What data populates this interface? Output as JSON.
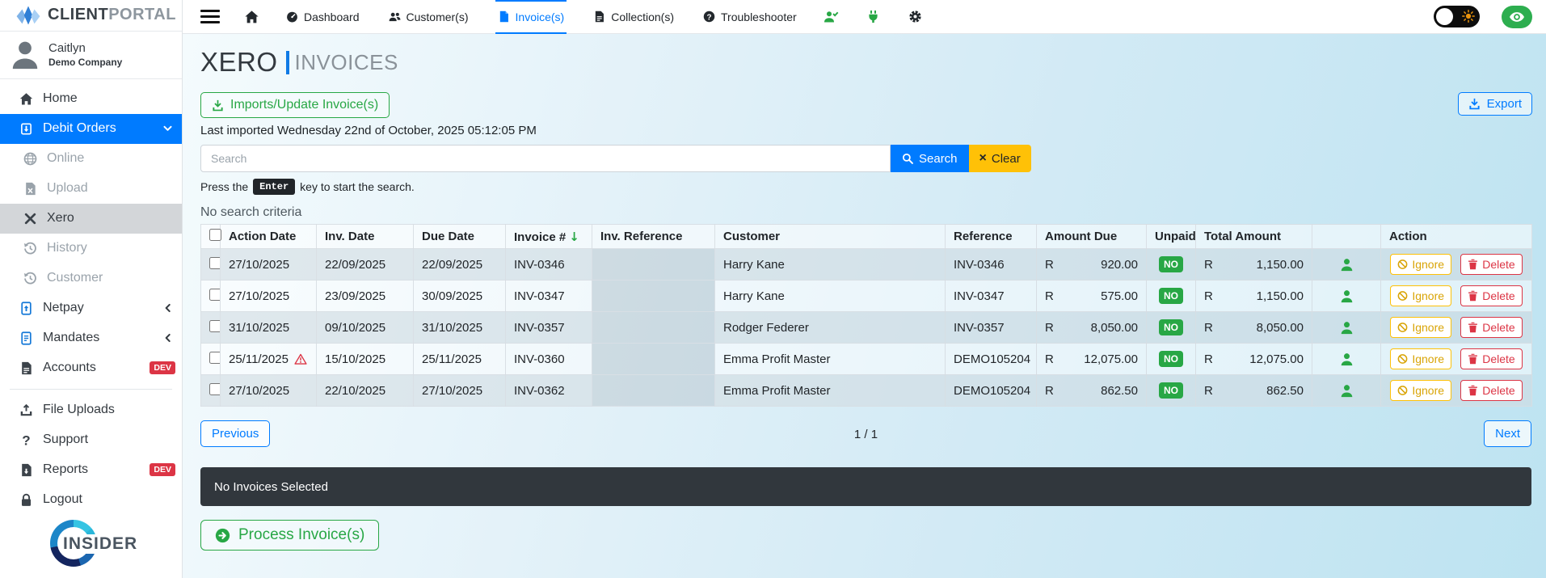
{
  "brand": {
    "name_primary": "CLIENT",
    "name_secondary": "PORTAL"
  },
  "user": {
    "name": "Caitlyn",
    "company": "Demo Company"
  },
  "sidebar": {
    "items": [
      {
        "label": "Home",
        "icon": "home-icon"
      },
      {
        "label": "Debit Orders",
        "icon": "file-import-icon",
        "active": true,
        "chevron": "down"
      },
      {
        "label": "Online",
        "icon": "globe-icon",
        "muted": true,
        "sub": true
      },
      {
        "label": "Upload",
        "icon": "file-excel-icon",
        "muted": true,
        "sub": true
      },
      {
        "label": "Xero",
        "icon": "x-mark-icon",
        "selected": true,
        "sub": true
      },
      {
        "label": "History",
        "icon": "history-icon",
        "muted": true,
        "sub": true
      },
      {
        "label": "Customer",
        "icon": "history-icon",
        "muted": true,
        "sub": true
      },
      {
        "label": "Netpay",
        "icon": "file-arrow-up-icon",
        "icon_color": "blue",
        "chevron": "left"
      },
      {
        "label": "Mandates",
        "icon": "file-lines-outline-icon",
        "icon_color": "blue",
        "chevron": "left"
      },
      {
        "label": "Accounts",
        "icon": "file-invoice-icon",
        "badge": "DEV"
      },
      {
        "divider": true
      },
      {
        "label": "File Uploads",
        "icon": "upload-icon"
      },
      {
        "label": "Support",
        "icon": "question-icon"
      },
      {
        "label": "Reports",
        "icon": "file-download-icon",
        "badge": "DEV"
      },
      {
        "label": "Logout",
        "icon": "lock-icon"
      }
    ],
    "insider_label": "INSIDER"
  },
  "topnav": {
    "tabs": [
      {
        "label": "Dashboard",
        "icon": "tachometer-icon"
      },
      {
        "label": "Customer(s)",
        "icon": "users-icon"
      },
      {
        "label": "Invoice(s)",
        "icon": "file-solid-icon",
        "active": true
      },
      {
        "label": "Collection(s)",
        "icon": "file-lines-icon"
      },
      {
        "label": "Troubleshooter",
        "icon": "question-circle-icon"
      }
    ],
    "right_icons": [
      {
        "icon": "user-check-icon",
        "color": "green"
      },
      {
        "icon": "plug-icon",
        "color": "green"
      },
      {
        "icon": "gear-icon",
        "color": "dark"
      }
    ]
  },
  "page": {
    "title_primary": "XERO",
    "title_secondary": "INVOICES"
  },
  "toolbar": {
    "import_label": "Imports/Update Invoice(s)",
    "export_label": "Export",
    "last_imported": "Last imported Wednesday 22nd of October, 2025 05:12:05 PM"
  },
  "search": {
    "placeholder": "Search",
    "search_label": "Search",
    "clear_label": "Clear",
    "hint_prefix": "Press the",
    "hint_key": "Enter",
    "hint_suffix": "key to start the search.",
    "criteria_text": "No search criteria"
  },
  "table": {
    "headers": {
      "action_date": "Action Date",
      "inv_date": "Inv. Date",
      "due_date": "Due Date",
      "invoice_no": "Invoice #",
      "inv_reference": "Inv. Reference",
      "customer": "Customer",
      "reference": "Reference",
      "amount_due": "Amount Due",
      "unpaid": "Unpaid",
      "total_amount": "Total Amount",
      "action": "Action"
    },
    "sort_arrow": "↓",
    "currency": "R",
    "unpaid_badge": "NO",
    "row_actions": {
      "ignore_label": "Ignore",
      "delete_label": "Delete"
    },
    "rows": [
      {
        "action_date": "27/10/2025",
        "warning": false,
        "inv_date": "22/09/2025",
        "due_date": "22/09/2025",
        "invoice_no": "INV-0346",
        "inv_reference": "",
        "customer": "Harry Kane",
        "reference": "INV-0346",
        "amount_due": "920.00",
        "unpaid": "NO",
        "total_amount": "1,150.00"
      },
      {
        "action_date": "27/10/2025",
        "warning": false,
        "inv_date": "23/09/2025",
        "due_date": "30/09/2025",
        "invoice_no": "INV-0347",
        "inv_reference": "",
        "customer": "Harry Kane",
        "reference": "INV-0347",
        "amount_due": "575.00",
        "unpaid": "NO",
        "total_amount": "1,150.00"
      },
      {
        "action_date": "31/10/2025",
        "warning": false,
        "inv_date": "09/10/2025",
        "due_date": "31/10/2025",
        "invoice_no": "INV-0357",
        "inv_reference": "",
        "customer": "Rodger Federer",
        "reference": "INV-0357",
        "amount_due": "8,050.00",
        "unpaid": "NO",
        "total_amount": "8,050.00"
      },
      {
        "action_date": "25/11/2025",
        "warning": true,
        "inv_date": "15/10/2025",
        "due_date": "25/11/2025",
        "invoice_no": "INV-0360",
        "inv_reference": "",
        "customer": "Emma Profit Master",
        "reference": "DEMO105204",
        "amount_due": "12,075.00",
        "unpaid": "NO",
        "total_amount": "12,075.00"
      },
      {
        "action_date": "27/10/2025",
        "warning": false,
        "inv_date": "22/10/2025",
        "due_date": "27/10/2025",
        "invoice_no": "INV-0362",
        "inv_reference": "",
        "customer": "Emma Profit Master",
        "reference": "DEMO105204",
        "amount_due": "862.50",
        "unpaid": "NO",
        "total_amount": "862.50"
      }
    ]
  },
  "pagination": {
    "previous_label": "Previous",
    "page_info": "1 / 1",
    "next_label": "Next"
  },
  "selection": {
    "message": "No Invoices Selected"
  },
  "process": {
    "label": "Process Invoice(s)"
  },
  "colors": {
    "primary": "#007bff",
    "success": "#28a745",
    "warning": "#ffc107",
    "danger": "#dc3545"
  }
}
